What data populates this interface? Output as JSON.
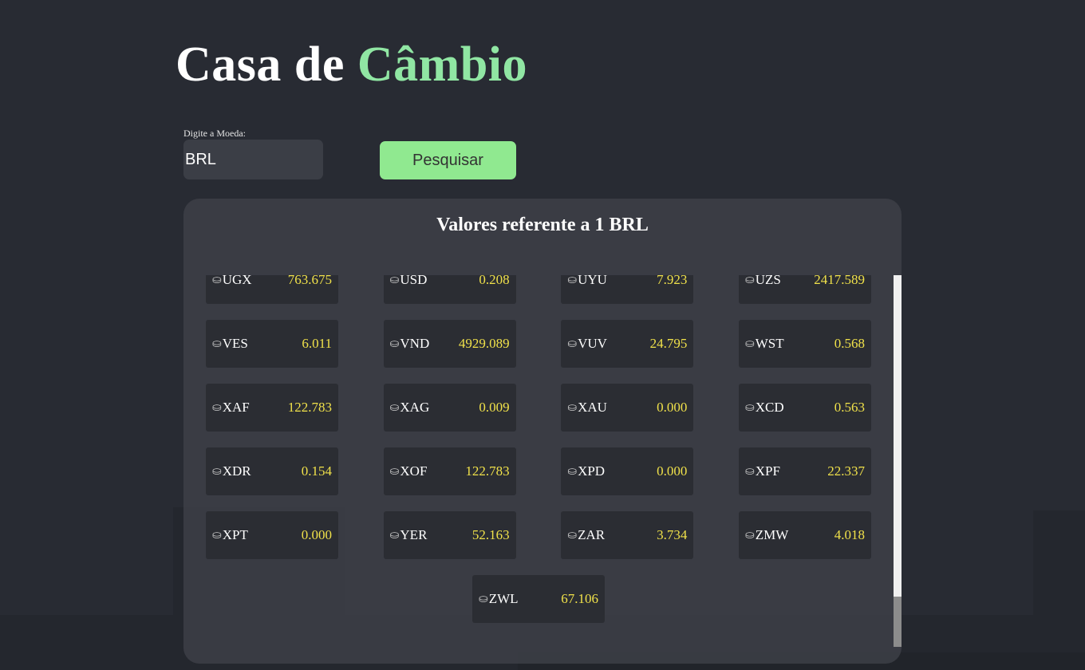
{
  "header": {
    "title_main": "Casa de ",
    "title_accent": "Câmbio"
  },
  "search": {
    "label": "Digite a Moeda:",
    "value": "BRL",
    "button_label": "Pesquisar"
  },
  "results": {
    "title": "Valores referente a 1 BRL",
    "coin_icon": "coin-stack-icon",
    "rates": [
      {
        "code": "UGX",
        "value": "763.675"
      },
      {
        "code": "USD",
        "value": "0.208"
      },
      {
        "code": "UYU",
        "value": "7.923"
      },
      {
        "code": "UZS",
        "value": "2417.589"
      },
      {
        "code": "VES",
        "value": "6.011"
      },
      {
        "code": "VND",
        "value": "4929.089"
      },
      {
        "code": "VUV",
        "value": "24.795"
      },
      {
        "code": "WST",
        "value": "0.568"
      },
      {
        "code": "XAF",
        "value": "122.783"
      },
      {
        "code": "XAG",
        "value": "0.009"
      },
      {
        "code": "XAU",
        "value": "0.000"
      },
      {
        "code": "XCD",
        "value": "0.563"
      },
      {
        "code": "XDR",
        "value": "0.154"
      },
      {
        "code": "XOF",
        "value": "122.783"
      },
      {
        "code": "XPD",
        "value": "0.000"
      },
      {
        "code": "XPF",
        "value": "22.337"
      },
      {
        "code": "XPT",
        "value": "0.000"
      },
      {
        "code": "YER",
        "value": "52.163"
      },
      {
        "code": "ZAR",
        "value": "3.734"
      },
      {
        "code": "ZMW",
        "value": "4.018"
      },
      {
        "code": "ZWL",
        "value": "67.106"
      }
    ]
  },
  "colors": {
    "background": "#282b33",
    "accent": "#90e6a3",
    "button": "#90e990",
    "value_text": "#f0e14a"
  }
}
